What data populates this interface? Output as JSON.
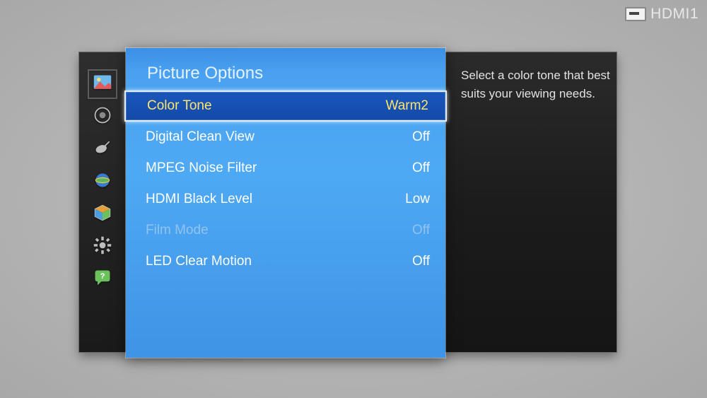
{
  "source": {
    "label": "HDMI1"
  },
  "panel": {
    "title": "Picture Options"
  },
  "help": {
    "text": "Select a color tone that best suits your viewing needs."
  },
  "menu": {
    "items": [
      {
        "label": "Color Tone",
        "value": "Warm2",
        "state": "selected"
      },
      {
        "label": "Digital Clean View",
        "value": "Off",
        "state": "normal"
      },
      {
        "label": "MPEG Noise Filter",
        "value": "Off",
        "state": "normal"
      },
      {
        "label": "HDMI Black Level",
        "value": "Low",
        "state": "normal"
      },
      {
        "label": "Film Mode",
        "value": "Off",
        "state": "disabled"
      },
      {
        "label": "LED Clear Motion",
        "value": "Off",
        "state": "normal"
      }
    ]
  },
  "sidebar": {
    "items": [
      {
        "name": "picture",
        "active": true
      },
      {
        "name": "sound",
        "active": false
      },
      {
        "name": "broadcast",
        "active": false
      },
      {
        "name": "network",
        "active": false
      },
      {
        "name": "smart",
        "active": false
      },
      {
        "name": "system",
        "active": false
      },
      {
        "name": "support",
        "active": false
      }
    ]
  }
}
